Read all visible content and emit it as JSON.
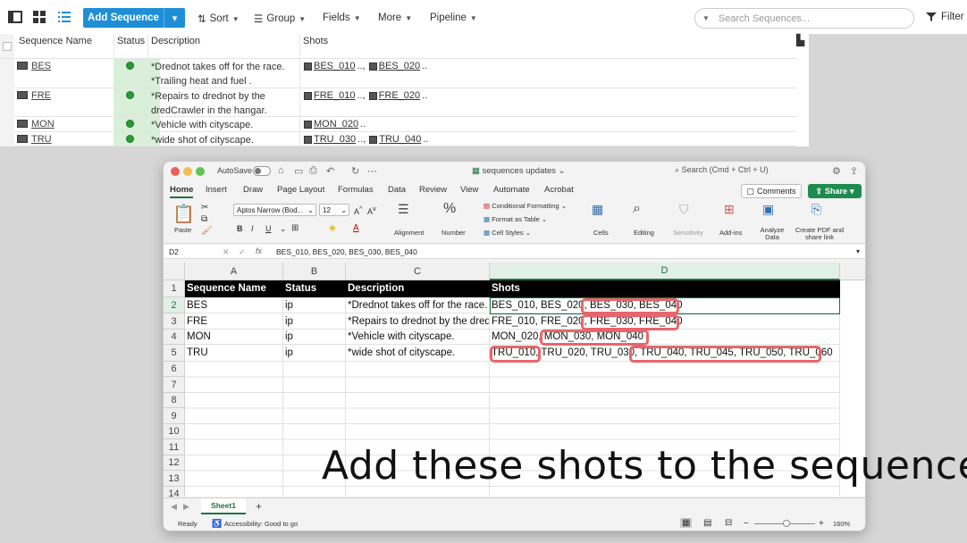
{
  "app": {
    "add_button": "Add Sequence",
    "toolbar": [
      "Sort",
      "Group",
      "Fields",
      "More",
      "Pipeline"
    ],
    "search_placeholder": "Search Sequences...",
    "filter_label": "Filter",
    "columns": [
      "Sequence Name",
      "Status",
      "Description",
      "Shots"
    ],
    "rows": [
      {
        "name": "BES",
        "desc": "*Drednot takes off for the race. *Trailing heat and fuel .",
        "shots": [
          "BES_010",
          "BES_020"
        ]
      },
      {
        "name": "FRE",
        "desc": "*Repairs to drednot by the dredCrawler in the hangar.",
        "shots": [
          "FRE_010",
          "FRE_020"
        ]
      },
      {
        "name": "MON",
        "desc": "*Vehicle with cityscape.",
        "shots": [
          "MON_020"
        ]
      },
      {
        "name": "TRU",
        "desc": "*wide shot of cityscape.",
        "shots": [
          "TRU_030",
          "TRU_040"
        ]
      }
    ]
  },
  "excel": {
    "autosave": "AutoSave",
    "filename": "sequences updates",
    "search": "Search (Cmd + Ctrl + U)",
    "tabs": [
      "Home",
      "Insert",
      "Draw",
      "Page Layout",
      "Formulas",
      "Data",
      "Review",
      "View",
      "Automate",
      "Acrobat"
    ],
    "comments": "Comments",
    "share": "Share",
    "ribbon": {
      "paste": "Paste",
      "font": "Aptos Narrow (Bod...",
      "size": "12",
      "alignment": "Alignment",
      "number": "Number",
      "cond_format": "Conditional Formatting",
      "format_table": "Format as Table",
      "cell_styles": "Cell Styles",
      "cells": "Cells",
      "editing": "Editing",
      "sensitivity": "Sensitivity",
      "addins": "Add-ins",
      "analyze": "Analyze Data",
      "create_pdf": "Create PDF and share link"
    },
    "cell_ref": "D2",
    "formula": "BES_010, BES_020, BES_030, BES_040",
    "col_headers": [
      "A",
      "B",
      "C",
      "D"
    ],
    "row_numbers": [
      "1",
      "2",
      "3",
      "4",
      "5",
      "6",
      "7",
      "8",
      "9",
      "10",
      "11",
      "12",
      "13",
      "14"
    ],
    "header_row": [
      "Sequence Name",
      "Status",
      "Description",
      "Shots"
    ],
    "data_rows": [
      [
        "BES",
        "ip",
        "*Drednot takes off for the race.",
        "BES_010, BES_020, BES_030, BES_040"
      ],
      [
        "FRE",
        "ip",
        "*Repairs to drednot by the dredCrawler in the hangar.",
        "FRE_010, FRE_020, FRE_030, FRE_040"
      ],
      [
        "MON",
        "ip",
        "*Vehicle with cityscape.",
        "MON_020, MON_030, MON_040"
      ],
      [
        "TRU",
        "ip",
        "*wide shot of cityscape.",
        "TRU_010, TRU_020, TRU_030, TRU_040, TRU_045, TRU_050, TRU_060"
      ]
    ],
    "sheet_tab": "Sheet1",
    "status": {
      "ready": "Ready",
      "accessibility": "Accessibility: Good to go",
      "zoom": "160%"
    }
  },
  "caption": "Add these shots to the sequences",
  "colors": {
    "accent": "#1e8fd6",
    "excel_green": "#1e7145",
    "highlight": "#e7666b"
  }
}
